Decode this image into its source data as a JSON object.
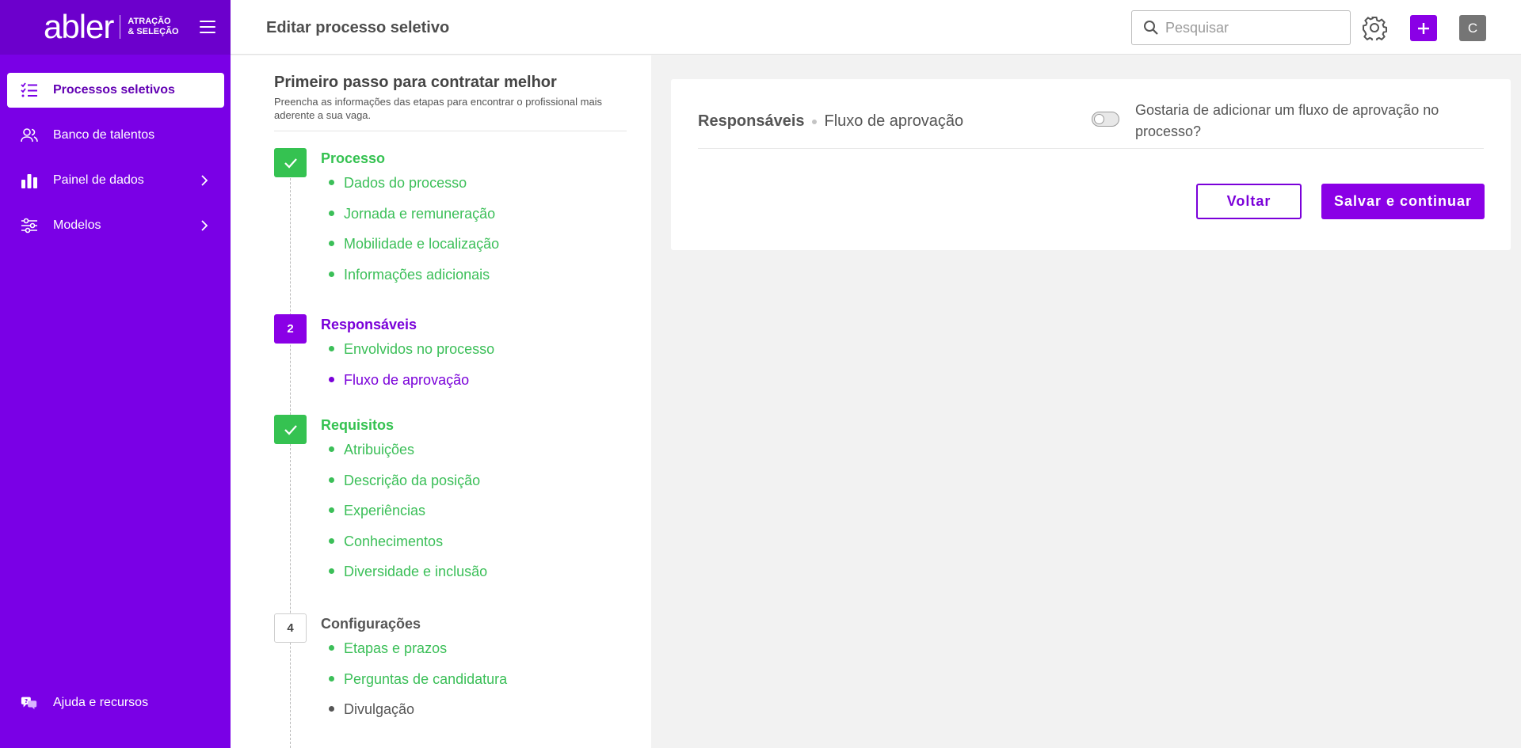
{
  "colors": {
    "brand_purple": "#7a00e6",
    "accent_purple": "#8a00e6",
    "done_green": "#35c251",
    "avatar_gray": "#757575"
  },
  "sidebar": {
    "logo_text": "abler",
    "logo_tagline": "ATRAÇÃO\n& SELEÇÃO",
    "menu_icon": "hamburger-icon",
    "items": [
      {
        "label": "Processos seletivos",
        "icon": "task-list-icon",
        "active": true,
        "has_chevron": false
      },
      {
        "label": "Banco de talentos",
        "icon": "people-icon",
        "active": false,
        "has_chevron": false
      },
      {
        "label": "Painel de dados",
        "icon": "bar-chart-icon",
        "active": false,
        "has_chevron": true
      },
      {
        "label": "Modelos",
        "icon": "sliders-icon",
        "active": false,
        "has_chevron": true
      }
    ],
    "help_label": "Ajuda e recursos",
    "help_icon": "chat-help-icon"
  },
  "topbar": {
    "title": "Editar processo seletivo",
    "search_placeholder": "Pesquisar",
    "search_value": "",
    "settings_icon": "gear-icon",
    "add_icon": "plus-icon",
    "avatar_initial": "C"
  },
  "steps_panel": {
    "title": "Primeiro passo para contratar melhor",
    "subtitle": "Preencha as informações das etapas para encontrar o profissional mais aderente a sua vaga.",
    "steps": [
      {
        "badge": "check-icon",
        "title": "Processo",
        "status": "done",
        "items": [
          {
            "label": "Dados do processo",
            "state": "done"
          },
          {
            "label": "Jornada e remuneração",
            "state": "done"
          },
          {
            "label": "Mobilidade e localização",
            "state": "done"
          },
          {
            "label": "Informações adicionais",
            "state": "done"
          }
        ]
      },
      {
        "badge": "2",
        "title": "Responsáveis",
        "status": "current",
        "items": [
          {
            "label": "Envolvidos no processo",
            "state": "done"
          },
          {
            "label": "Fluxo de aprovação",
            "state": "current"
          }
        ]
      },
      {
        "badge": "check-icon",
        "title": "Requisitos",
        "status": "done",
        "items": [
          {
            "label": "Atribuições",
            "state": "done"
          },
          {
            "label": "Descrição da posição",
            "state": "done"
          },
          {
            "label": "Experiências",
            "state": "done"
          },
          {
            "label": "Conhecimentos",
            "state": "done"
          },
          {
            "label": "Diversidade e inclusão",
            "state": "done"
          }
        ]
      },
      {
        "badge": "4",
        "title": "Configurações",
        "status": "pending",
        "items": [
          {
            "label": "Etapas e prazos",
            "state": "done"
          },
          {
            "label": "Perguntas de candidatura",
            "state": "done"
          },
          {
            "label": "Divulgação",
            "state": "pending"
          }
        ]
      }
    ]
  },
  "card": {
    "breadcrumb_section": "Responsáveis",
    "breadcrumb_page": "Fluxo de aprovação",
    "toggle_on": false,
    "toggle_label": "Gostaria de adicionar um fluxo de aprovação no processo?",
    "back_label": "Voltar",
    "save_label": "Salvar e continuar"
  }
}
